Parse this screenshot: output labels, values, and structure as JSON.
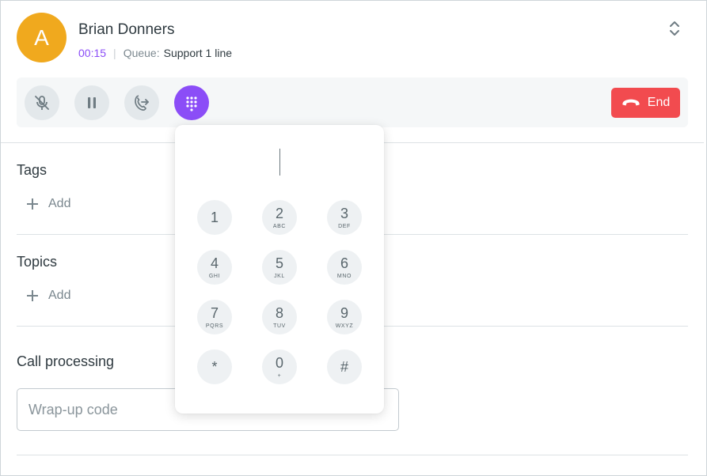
{
  "caller": {
    "avatar_initial": "A",
    "name": "Brian Donners",
    "timer": "00:15",
    "queue_label": "Queue:",
    "queue_value": "Support 1 line"
  },
  "controls": {
    "buttons": [
      {
        "name": "mute-button",
        "icon": "mic-off-icon"
      },
      {
        "name": "hold-button",
        "icon": "pause-icon"
      },
      {
        "name": "transfer-button",
        "icon": "call-transfer-icon"
      },
      {
        "name": "dialpad-button",
        "icon": "dialpad-icon",
        "active": true
      }
    ],
    "end_label": "End"
  },
  "sections": {
    "tags": {
      "title": "Tags",
      "add_label": "Add"
    },
    "topics": {
      "title": "Topics",
      "add_label": "Add"
    },
    "call_processing": {
      "title": "Call processing",
      "wrapup_placeholder": "Wrap-up code"
    }
  },
  "dialpad": {
    "keys": [
      {
        "digit": "1",
        "letters": ""
      },
      {
        "digit": "2",
        "letters": "ABC"
      },
      {
        "digit": "3",
        "letters": "DEF"
      },
      {
        "digit": "4",
        "letters": "GHI"
      },
      {
        "digit": "5",
        "letters": "JKL"
      },
      {
        "digit": "6",
        "letters": "MNO"
      },
      {
        "digit": "7",
        "letters": "PQRS"
      },
      {
        "digit": "8",
        "letters": "TUV"
      },
      {
        "digit": "9",
        "letters": "WXYZ"
      },
      {
        "digit": "*",
        "letters": ""
      },
      {
        "digit": "0",
        "letters": "+"
      },
      {
        "digit": "#",
        "letters": ""
      }
    ]
  },
  "colors": {
    "accent": "#8b4df7",
    "avatar": "#f0a91e",
    "end": "#f24b4f"
  }
}
